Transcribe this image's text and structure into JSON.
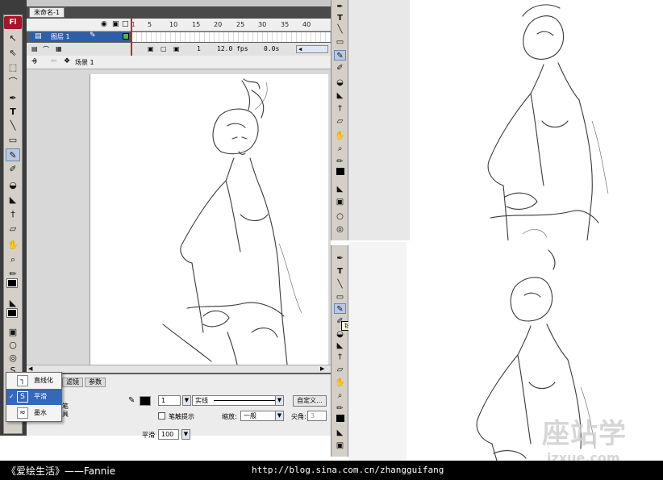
{
  "app": {
    "logo": "Fl"
  },
  "document": {
    "tab_label": "未命名-1"
  },
  "timeline": {
    "frame_numbers": [
      "5",
      "10",
      "15",
      "20",
      "25",
      "30",
      "35",
      "40"
    ],
    "current_frame_marker": "1",
    "layer_name": "图层 1",
    "frame": "1",
    "fps": "12.0 fps",
    "time": "0.0s"
  },
  "breadcrumb": {
    "scene": "场景 1"
  },
  "properties": {
    "tabs": [
      "滤镜",
      "参数"
    ],
    "tool_name_fragment_1": "铅笔",
    "tool_name_fragment_2": "工具",
    "stroke_height": "1",
    "stroke_style": "实线",
    "custom_button": "自定义...",
    "stroke_hinting_label": "笔触提示",
    "scale_label": "缩放:",
    "scale_value": "一般",
    "miter_label": "尖角:",
    "miter_value": "3",
    "smooth_label": "平滑",
    "smooth_value": "100"
  },
  "pencil_mode_menu": {
    "items": [
      {
        "label": "直线化",
        "icon": "straighten-icon",
        "glyph": "┐"
      },
      {
        "label": "平滑",
        "icon": "smooth-icon",
        "glyph": "S",
        "selected": true,
        "check": "✓"
      },
      {
        "label": "墨水",
        "icon": "ink-icon",
        "glyph": "≈"
      }
    ]
  },
  "tooltip": {
    "text": "铅笔工具 (Y)"
  },
  "caption": {
    "left": "《爱绘生活》——Fannie",
    "url": "http://blog.sina.com.cn/zhangguifang"
  },
  "watermark": {
    "main": "座站学",
    "sub": "jzxue.com"
  },
  "colors": {
    "accent": "#3767b8",
    "logo_red": "#a8142a",
    "frame_red": "#d42020"
  }
}
